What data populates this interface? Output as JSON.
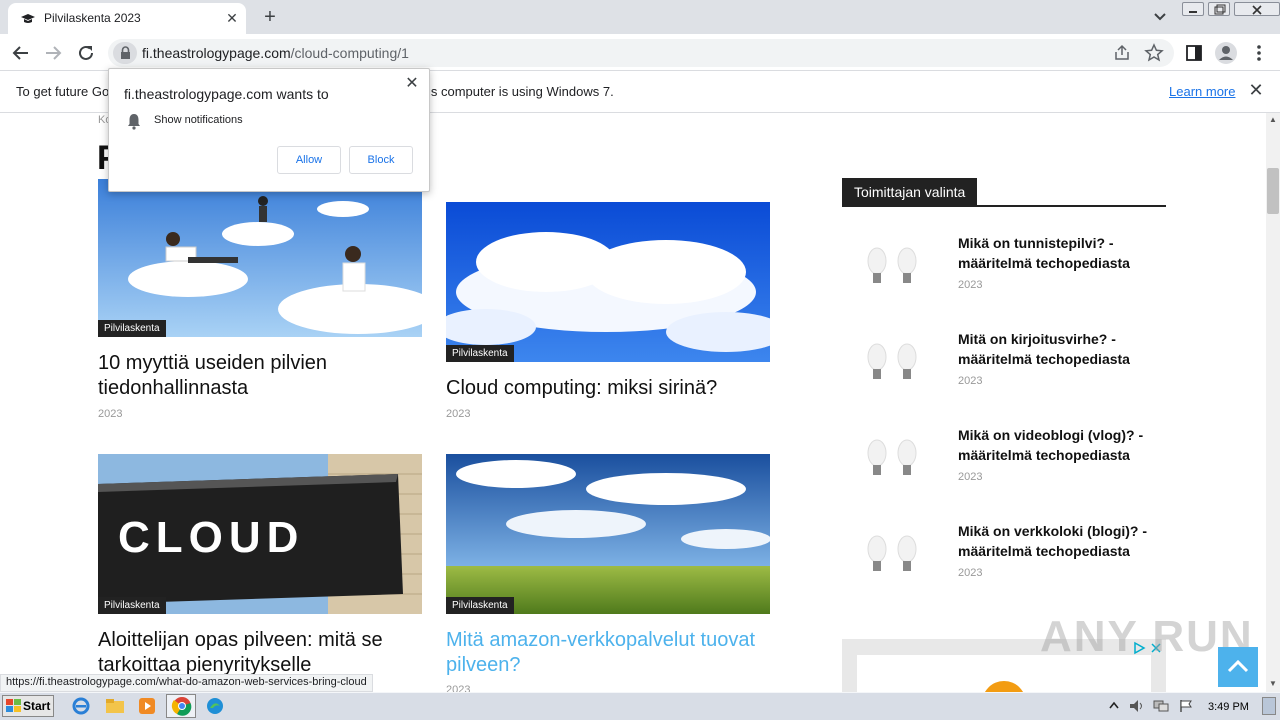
{
  "browser": {
    "tab_title": "Pilvilaskenta 2023",
    "new_tab": "+",
    "tab_close": "✕",
    "url_host": "fi.theastrologypage.com",
    "url_path": "/cloud-computing/1"
  },
  "infobar": {
    "text_left": "To get future Go",
    "text_right": "is computer is using Windows 7.",
    "learn_more": "Learn more",
    "close": "✕"
  },
  "popup": {
    "title": "fi.theastrologypage.com wants to",
    "permission": "Show notifications",
    "allow": "Allow",
    "block": "Block",
    "close": "✕"
  },
  "page": {
    "breadcrumb_fragment": "Ko",
    "heading_fragment": "P",
    "articles": [
      {
        "tag": "Pilvilaskenta",
        "title": "10 myyttiä useiden pilvien tiedonhallinnasta",
        "date": "2023"
      },
      {
        "tag": "Pilvilaskenta",
        "title": "Cloud computing: miksi sirinä?",
        "date": "2023"
      },
      {
        "tag": "Pilvilaskenta",
        "title": "Aloittelijan opas pilveen: mitä se tarkoittaa pienyritykselle",
        "date": ""
      },
      {
        "tag": "Pilvilaskenta",
        "title": "Mitä amazon-verkkopalvelut tuovat pilveen?",
        "date": "2023"
      }
    ],
    "cloud_sign_text": "CLOUD"
  },
  "sidebar": {
    "header": "Toimittajan valinta",
    "picks": [
      {
        "title": "Mikä on tunnistepilvi? - määritelmä techopediasta",
        "date": "2023"
      },
      {
        "title": "Mitä on kirjoitusvirhe? - määritelmä techopediasta",
        "date": "2023"
      },
      {
        "title": "Mikä on videoblogi (vlog)? - määritelmä techopediasta",
        "date": "2023"
      },
      {
        "title": "Mikä on verkkoloki (blogi)? - määritelmä techopediasta",
        "date": "2023"
      }
    ]
  },
  "status_url": "https://fi.theastrologypage.com/what-do-amazon-web-services-bring-cloud",
  "watermark": "ANY RUN",
  "taskbar": {
    "start": "Start",
    "clock": "3:49 PM"
  },
  "colors": {
    "accent": "#4db2ec",
    "tag_bg": "#222222",
    "link_blue": "#1a73e8"
  }
}
